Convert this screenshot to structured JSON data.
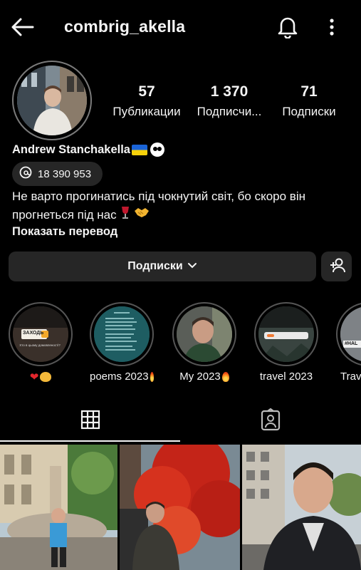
{
  "header": {
    "username": "combrig_akella",
    "back_icon": "arrow-left-icon",
    "bell_icon": "bell-icon",
    "more_icon": "vertical-dots-icon"
  },
  "profile": {
    "stats": [
      {
        "value": "57",
        "label": "Публикации"
      },
      {
        "value": "1 370",
        "label": "Подписчи..."
      },
      {
        "value": "71",
        "label": "Подписки"
      }
    ],
    "full_name": "Andrew Stanchakella",
    "threads_count": "18 390 953",
    "bio_line1": "Не варто прогинатись під чокнутий світ, бо скоро він",
    "bio_line2": "прогнеться під нас",
    "translate_label": "Показать перевод"
  },
  "actions": {
    "following_label": "Подписки",
    "add_user_icon": "add-user-icon"
  },
  "highlights": [
    {
      "label": "",
      "sticker_text": "ЗАХОДЬ",
      "caption_small": "Хто в цьому домовленості?"
    },
    {
      "label": "poems 2023"
    },
    {
      "label": "My 2023"
    },
    {
      "label": "travel 2023"
    },
    {
      "label": "Trav",
      "badge": "#HAL"
    }
  ],
  "tabs": [
    {
      "icon": "grid-icon"
    },
    {
      "icon": "tagged-person-icon"
    }
  ],
  "colors": {
    "background": "#000000",
    "button_bg": "#262626",
    "text": "#f5f5f5"
  }
}
